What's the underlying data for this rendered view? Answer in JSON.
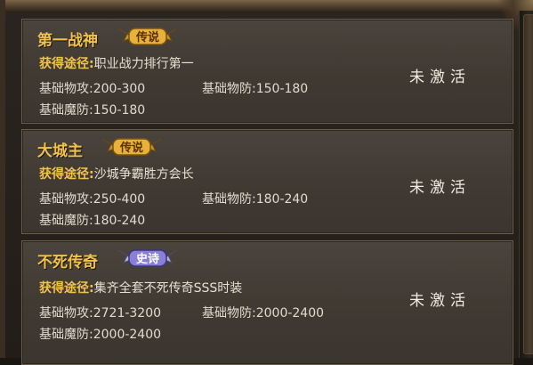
{
  "titles": [
    {
      "name": "第一战神",
      "badge": "传说",
      "badge_color": "#e8b23a",
      "source_label": "获得途径:",
      "source": "职业战力排行第一",
      "attack_label": "基础物攻:",
      "attack": "200-300",
      "defense_label": "基础物防:",
      "defense": "150-180",
      "magic_def_label": "基础魔防:",
      "magic_def": "150-180",
      "status": "未激活"
    },
    {
      "name": "大城主",
      "badge": "传说",
      "badge_color": "#e8b23a",
      "source_label": "获得途径:",
      "source": "沙城争霸胜方会长",
      "attack_label": "基础物攻:",
      "attack": "250-400",
      "defense_label": "基础物防:",
      "defense": "180-240",
      "magic_def_label": "基础魔防:",
      "magic_def": "180-240",
      "status": "未激活"
    },
    {
      "name": "不死传奇",
      "badge": "史诗",
      "badge_color": "#8a7fd6",
      "source_label": "获得途径:",
      "source": "集齐全套不死传奇SSS时装",
      "attack_label": "基础物攻:",
      "attack": "2721-3200",
      "defense_label": "基础物防:",
      "defense": "2000-2400",
      "magic_def_label": "基础魔防:",
      "magic_def": "2000-2400",
      "status": "未激活"
    }
  ]
}
